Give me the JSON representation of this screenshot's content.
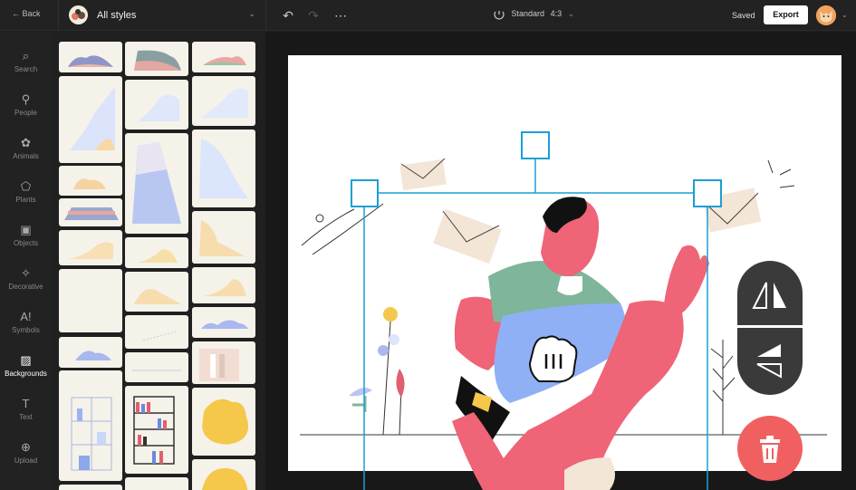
{
  "topbar": {
    "back_label": "Back",
    "style_label": "All styles",
    "canvas_size_label": "Standard",
    "canvas_ratio": "4:3",
    "saved_label": "Saved",
    "export_label": "Export"
  },
  "icons": {
    "back": "arrow-left-icon",
    "undo": "undo-icon",
    "redo": "redo-icon",
    "more": "ellipsis-icon",
    "resize": "resize-icon",
    "chevron": "chevron-down-icon"
  },
  "rail": [
    {
      "label": "Search",
      "icon": "search-icon",
      "glyph": "⌕"
    },
    {
      "label": "People",
      "icon": "person-icon",
      "glyph": "⚲"
    },
    {
      "label": "Animals",
      "icon": "paw-icon",
      "glyph": "✿"
    },
    {
      "label": "Plants",
      "icon": "leaf-icon",
      "glyph": "⬠"
    },
    {
      "label": "Objects",
      "icon": "cube-icon",
      "glyph": "▣"
    },
    {
      "label": "Decorative",
      "icon": "sparkle-icon",
      "glyph": "✧"
    },
    {
      "label": "Symbols",
      "icon": "symbols-icon",
      "glyph": "A!"
    },
    {
      "label": "Backgrounds",
      "icon": "image-icon",
      "glyph": "▨"
    },
    {
      "label": "Text",
      "icon": "text-icon",
      "glyph": "T"
    },
    {
      "label": "Upload",
      "icon": "upload-icon",
      "glyph": "⊕"
    }
  ],
  "active_rail": "Backgrounds",
  "colors": {
    "accent": "#1a9fd6",
    "delete": "#f06060",
    "figure": "#ef6476",
    "shirt": "#7fb59a",
    "shorts": "#8fb0f5",
    "envelope": "#f3e6d6"
  }
}
